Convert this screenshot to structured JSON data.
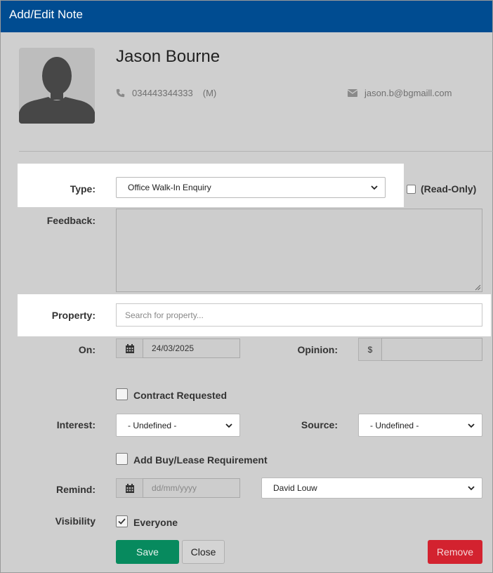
{
  "dialog": {
    "title": "Add/Edit Note"
  },
  "contact": {
    "name": "Jason Bourne",
    "phone": "034443344333",
    "phone_type": "(M)",
    "email": "jason.b@bgmaill.com"
  },
  "form": {
    "type_label": "Type:",
    "type_value": "Office Walk-In Enquiry",
    "readonly_label": "(Read-Only)",
    "feedback_label": "Feedback:",
    "property_label": "Property:",
    "property_placeholder": "Search for property...",
    "on_label": "On:",
    "on_date": "24/03/2025",
    "opinion_label": "Opinion:",
    "currency_symbol": "$",
    "contract_label": "Contract Requested",
    "interest_label": "Interest:",
    "interest_value": "- Undefined -",
    "source_label": "Source:",
    "source_value": "- Undefined -",
    "buylease_label": "Add Buy/Lease Requirement",
    "remind_label": "Remind:",
    "remind_placeholder": "dd/mm/yyyy",
    "remind_user": "David Louw",
    "visibility_label": "Visibility",
    "everyone_label": "Everyone",
    "everyone_checked": true
  },
  "buttons": {
    "save": "Save",
    "close": "Close",
    "remove": "Remove"
  },
  "colors": {
    "titlebar": "#004c91",
    "save": "#078a5e",
    "remove": "#d3222f"
  }
}
